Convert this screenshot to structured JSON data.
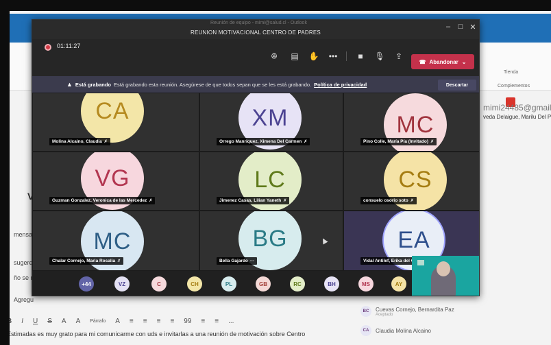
{
  "outlook": {
    "ribbon_labels": [
      "Tienda",
      "Complementos"
    ],
    "email": "mimi24485@gmail",
    "attendee_names_line": "veda Delaigue, Marilu Del Pi",
    "left_labels": [
      "mensaj",
      "sugerer",
      "ño se r",
      "Agregu"
    ],
    "v_label": "V",
    "attendees": [
      {
        "initials": "BC",
        "name": "Cuevas Cornejo, Bernardita Paz",
        "status": "Aceptado"
      },
      {
        "initials": "CA",
        "name": "Claudia Molina Alcaino",
        "status": ""
      }
    ],
    "format_toolbar": [
      "B",
      "I",
      "U",
      "S",
      "A",
      "A",
      "Párrafo",
      "A",
      "≡",
      "≡",
      "≡",
      "≡",
      "99",
      "≡",
      "≡",
      "..."
    ],
    "body_text": "Estimadas es muy grato para mi comunicarme con uds e invitarlas a una reunión de  motivación sobre Centro"
  },
  "window": {
    "outlook_ghost_title": "Reunión de equipo - mimi@salud.cl - Outlook",
    "meeting_title": "REUNION MOTIVACIONAL CENTRO DE PADRES",
    "timer": "01:11:27",
    "leave_label": "Abandonar"
  },
  "banner": {
    "bold": "Está grabando",
    "text": "Está grabando esta reunión. Asegúrese de que todos sepan que se les está grabando.",
    "link": "Política de privacidad",
    "dismiss": "Descartar"
  },
  "participants": [
    {
      "initials": "CA",
      "name": "Molina Alcaino, Claudia",
      "avatar_bg": "#f3e6a8",
      "avatar_fg": "#b58a1f"
    },
    {
      "initials": "XM",
      "name": "Orrego Manriquez, Ximena Del Carmen",
      "avatar_bg": "#e7e3f6",
      "avatar_fg": "#4c4392"
    },
    {
      "initials": "MC",
      "name": "Pino Colle, María Pía (Invitado)",
      "avatar_bg": "#f6dadd",
      "avatar_fg": "#a1343e"
    },
    {
      "initials": "VG",
      "name": "Guzman Gonzalez, Veronica de las Mercedez",
      "avatar_bg": "#f7d7de",
      "avatar_fg": "#b23650"
    },
    {
      "initials": "LC",
      "name": "Jimenez Casas, Lilian Yaneth",
      "avatar_bg": "#e3edc8",
      "avatar_fg": "#5f7a1b"
    },
    {
      "initials": "CS",
      "name": "consuelo osorio soto",
      "avatar_bg": "#f5e3a6",
      "avatar_fg": "#a57d12"
    },
    {
      "initials": "MC",
      "name": "Chalar Cornejo, Maria Rosalia",
      "avatar_bg": "#d8e7f2",
      "avatar_fg": "#2f5f86"
    },
    {
      "initials": "BG",
      "name": "Bella Gajardo",
      "avatar_bg": "#d7ecee",
      "avatar_fg": "#2a7b86"
    },
    {
      "initials": "EA",
      "name": "Vidal Antilef, Erika del Carmen",
      "avatar_bg": "#e9eef7",
      "avatar_fg": "#2f4f8c"
    }
  ],
  "roster": [
    {
      "label": "+44",
      "bg": "#6264a7",
      "fg": "#ffffff"
    },
    {
      "label": "VZ",
      "bg": "#e4e1f3",
      "fg": "#4c4392"
    },
    {
      "label": "C",
      "bg": "#f6dadd",
      "fg": "#a1343e"
    },
    {
      "label": "CH",
      "bg": "#f3e6a8",
      "fg": "#a57d12"
    },
    {
      "label": "PL",
      "bg": "#d7ecee",
      "fg": "#2a7b86"
    },
    {
      "label": "GB",
      "bg": "#f4d9d6",
      "fg": "#a3413a"
    },
    {
      "label": "RC",
      "bg": "#e3edc8",
      "fg": "#5f7a1b"
    },
    {
      "label": "BH",
      "bg": "#e7e3f6",
      "fg": "#4c4392"
    },
    {
      "label": "MS",
      "bg": "#f7d7de",
      "fg": "#b23650"
    },
    {
      "label": "AY",
      "bg": "#f5e3a6",
      "fg": "#a57d12"
    }
  ]
}
